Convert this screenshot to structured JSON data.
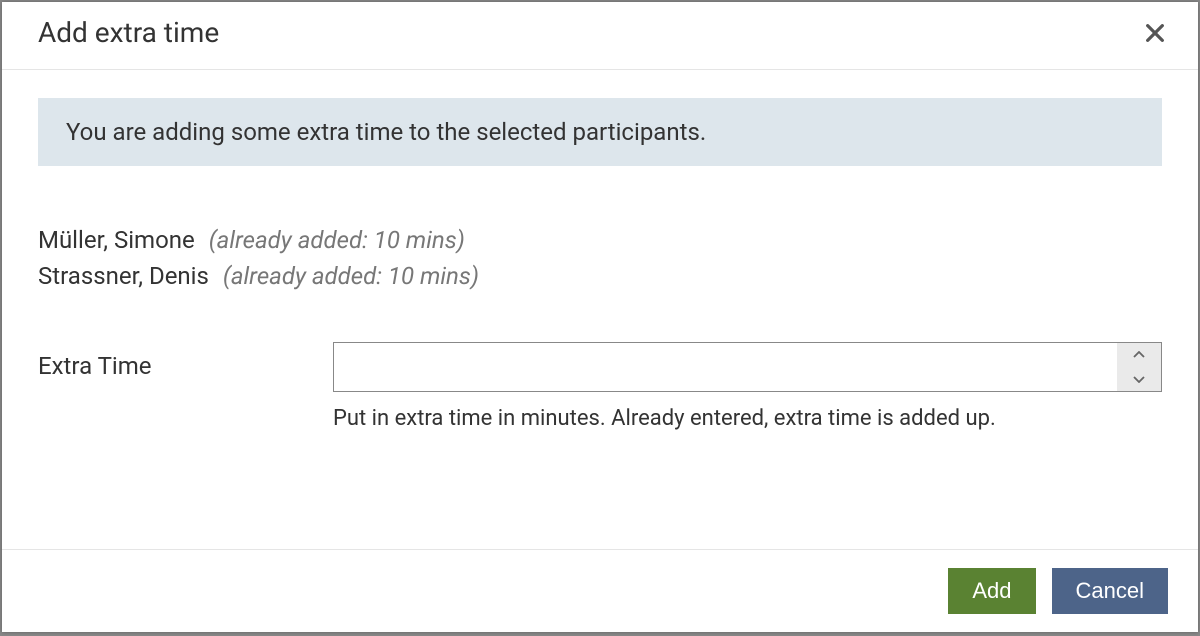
{
  "modal": {
    "title": "Add extra time",
    "info_message": "You are adding some extra time to the selected participants.",
    "participants": [
      {
        "name": "Müller, Simone",
        "note": "(already added: 10 mins)"
      },
      {
        "name": "Strassner, Denis",
        "note": "(already added: 10 mins)"
      }
    ],
    "form": {
      "label": "Extra Time",
      "input_value": "",
      "help_text": "Put in extra time in minutes. Already entered, extra time is added up."
    },
    "buttons": {
      "add": "Add",
      "cancel": "Cancel"
    }
  }
}
